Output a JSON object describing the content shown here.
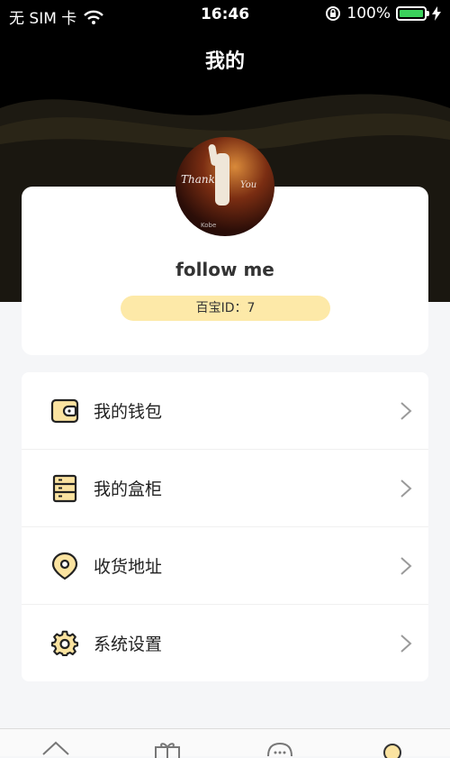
{
  "status_bar": {
    "carrier": "无 SIM 卡",
    "time": "16:46",
    "battery": "100%",
    "battery_level": 1.0
  },
  "header": {
    "title": "我的"
  },
  "profile": {
    "avatar_texts": [
      "Thank",
      "You",
      "Kobe"
    ],
    "username": "follow me",
    "id_label": "百宝ID：7"
  },
  "menu": {
    "items": [
      {
        "label": "我的钱包",
        "icon": "wallet-icon"
      },
      {
        "label": "我的盒柜",
        "icon": "cabinet-icon"
      },
      {
        "label": "收货地址",
        "icon": "location-pin-icon"
      },
      {
        "label": "系统设置",
        "icon": "gear-icon"
      }
    ]
  },
  "tabbar": {
    "icons": [
      "home-icon",
      "gift-icon",
      "chat-icon",
      "profile-icon"
    ]
  },
  "colors": {
    "accent": "#fde9a8",
    "icon_fill": "#fbe3a0",
    "header_bg": "#000000",
    "battery": "#3bd15c"
  }
}
